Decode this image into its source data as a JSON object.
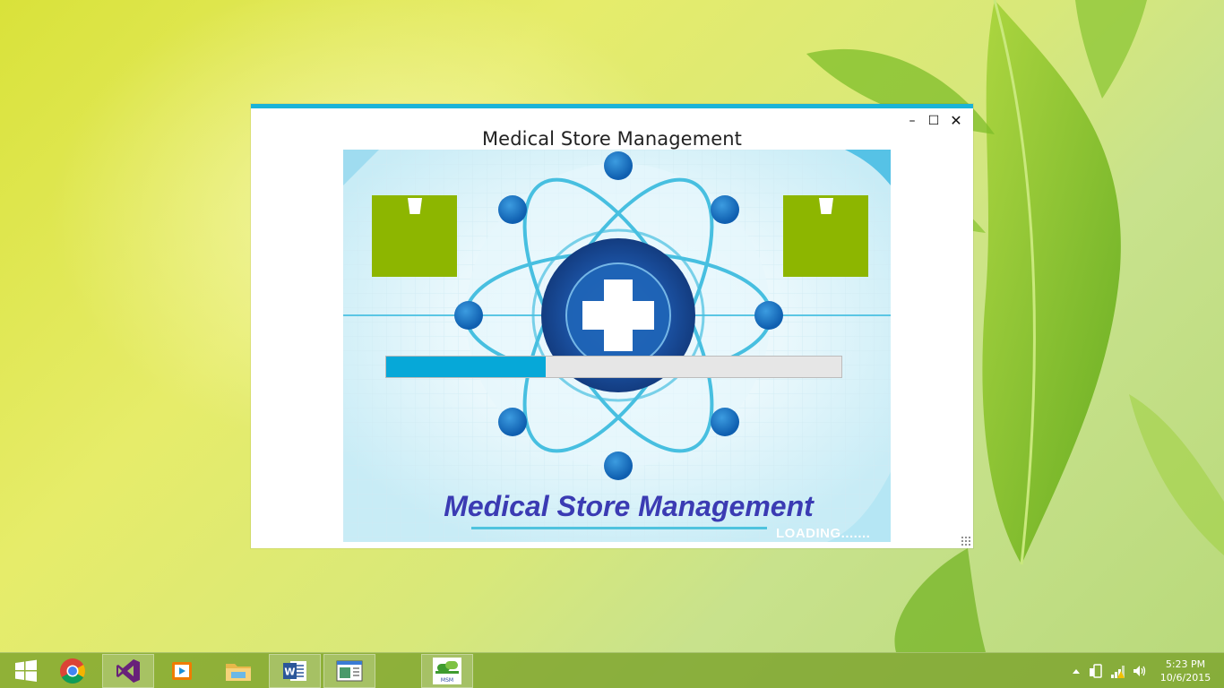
{
  "window": {
    "title": "Medical Store Management",
    "controls": {
      "minimize": "–",
      "maximize": "☐",
      "close": "✕"
    }
  },
  "splash": {
    "brand_text": "Medical Store Management",
    "loading_text": "LOADING.......",
    "progress": 0.35
  },
  "taskbar": {
    "apps": [
      {
        "name": "start",
        "icon": "windows-logo-icon"
      },
      {
        "name": "chrome",
        "icon": "chrome-icon"
      },
      {
        "name": "visual-studio",
        "icon": "visual-studio-icon"
      },
      {
        "name": "media-player",
        "icon": "media-player-icon"
      },
      {
        "name": "file-explorer",
        "icon": "folder-icon"
      },
      {
        "name": "word",
        "icon": "word-icon",
        "label": "W"
      },
      {
        "name": "app-window",
        "icon": "window-app-icon"
      },
      {
        "name": "msm",
        "icon": "msm-icon",
        "label": "MSM"
      }
    ],
    "clock": {
      "time": "5:23 PM",
      "date": "10/6/2015"
    }
  },
  "colors": {
    "accent": "#1ab3d8",
    "progress_fill": "#06a8d8",
    "green_box": "#8db600",
    "brand_text": "#3b3bb3",
    "taskbar": "#78a028"
  }
}
